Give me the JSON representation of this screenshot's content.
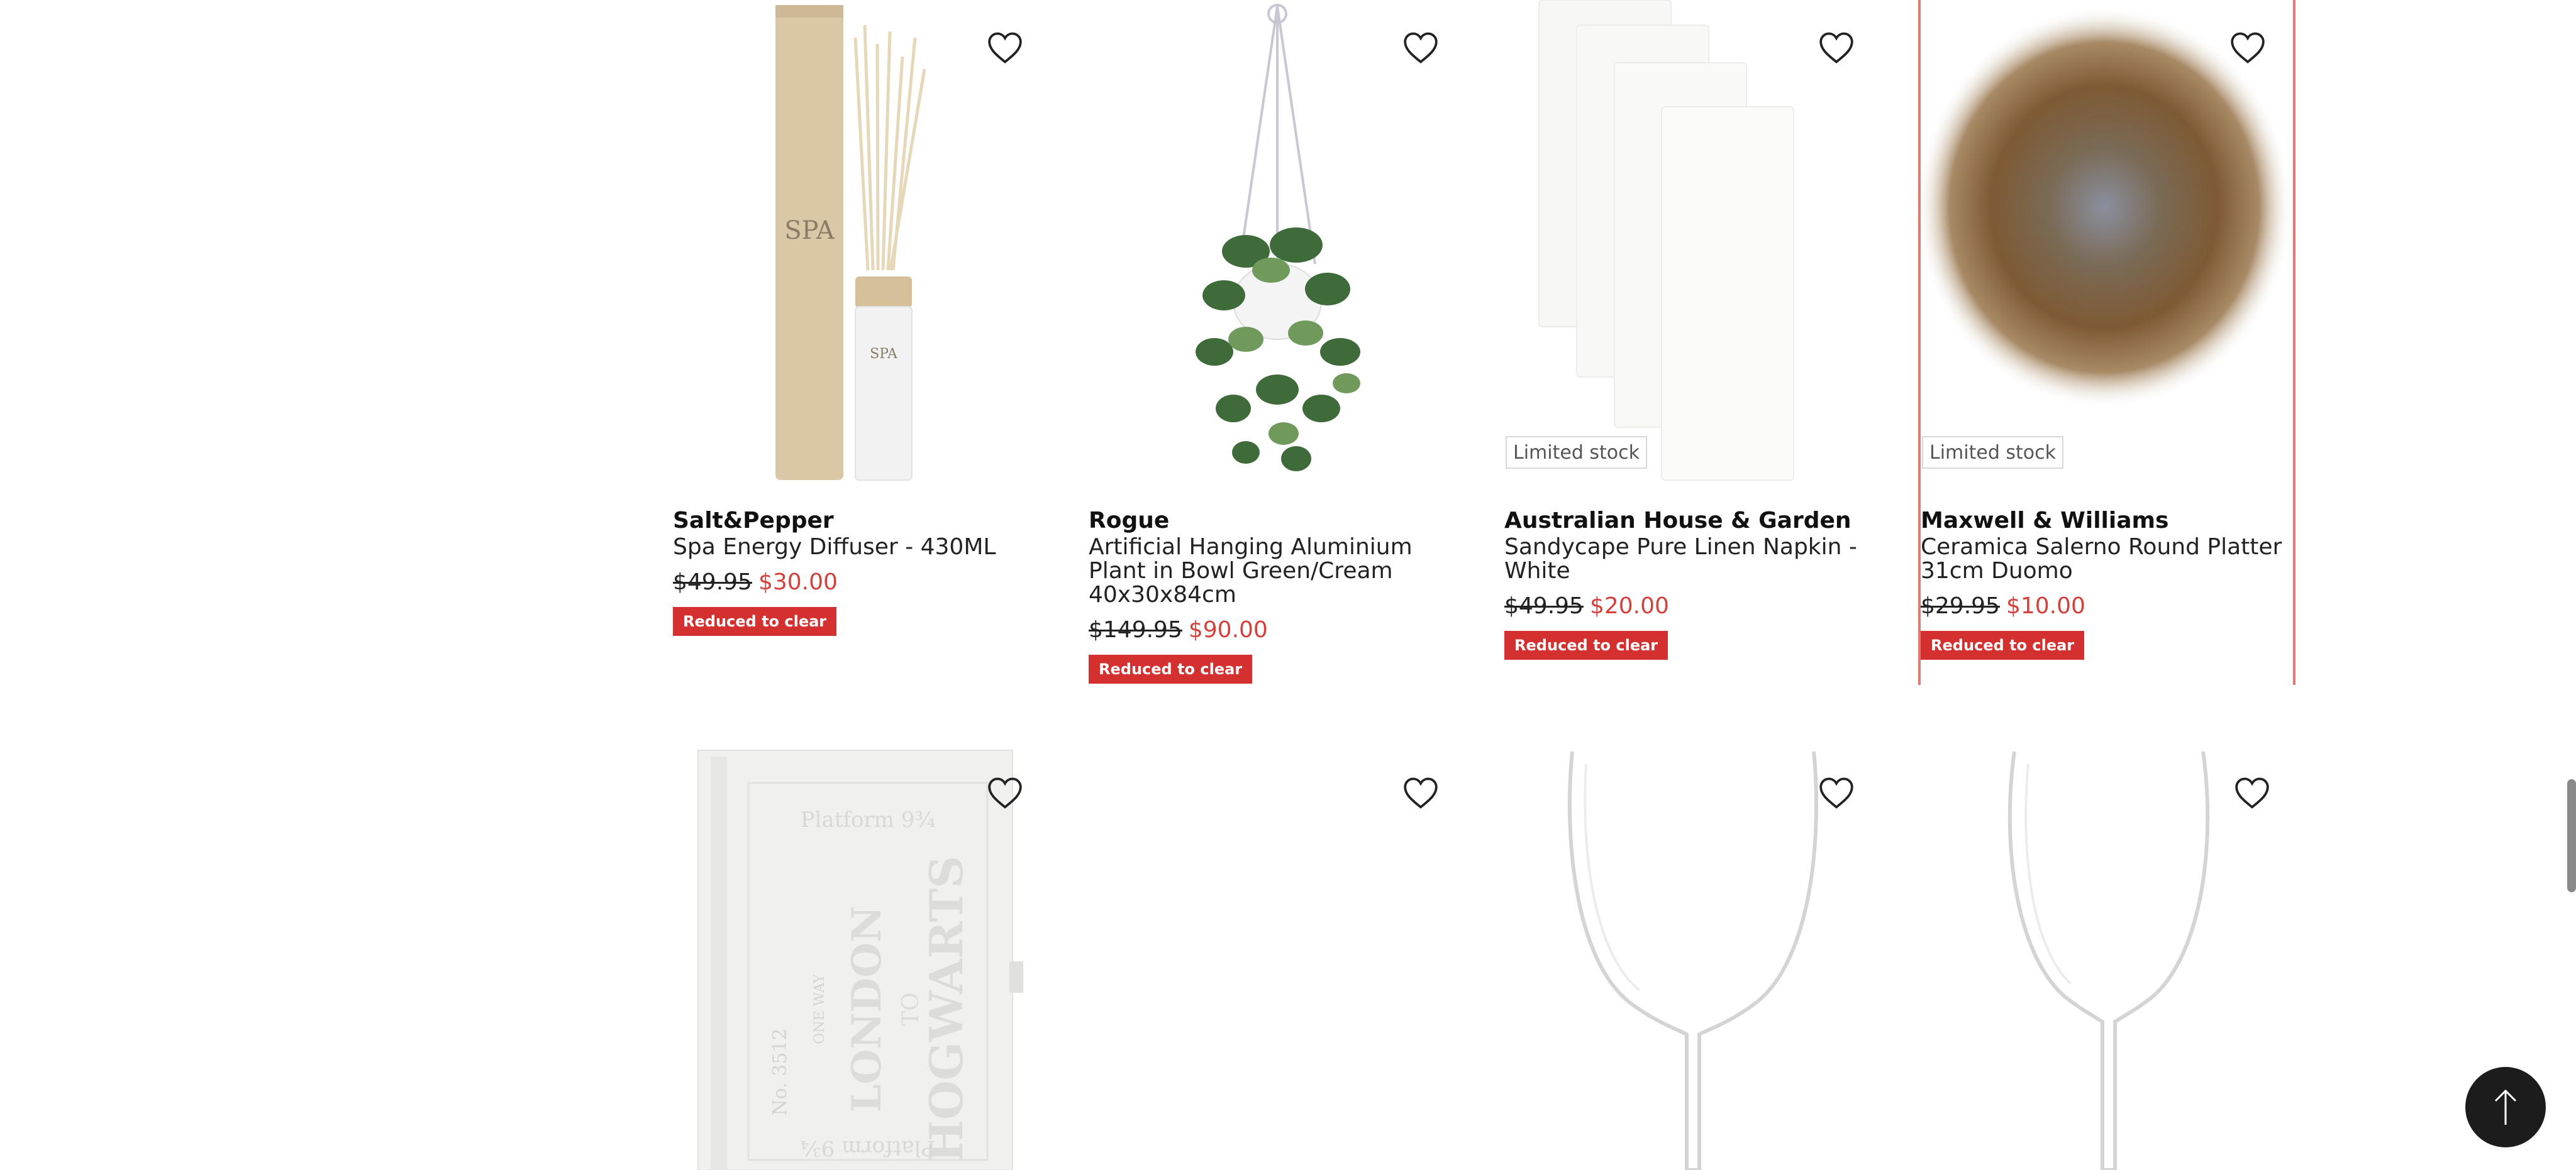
{
  "products": [
    {
      "brand": "Salt&Pepper",
      "name": "Spa Energy Diffuser - 430ML",
      "was_price": "$49.95",
      "now_price": "$30.00",
      "badge": "Reduced to clear",
      "stock": ""
    },
    {
      "brand": "Rogue",
      "name": "Artificial Hanging Aluminium Plant in Bowl Green/Cream 40x30x84cm",
      "was_price": "$149.95",
      "now_price": "$90.00",
      "badge": "Reduced to clear",
      "stock": ""
    },
    {
      "brand": "Australian House & Garden",
      "name": "Sandycape Pure Linen Napkin - White",
      "was_price": "$49.95",
      "now_price": "$20.00",
      "badge": "Reduced to clear",
      "stock": "Limited stock"
    },
    {
      "brand": "Maxwell & Williams",
      "name": "Ceramica Salerno Round Platter 31cm Duomo",
      "was_price": "$29.95",
      "now_price": "$10.00",
      "badge": "Reduced to clear",
      "stock": "Limited stock"
    }
  ],
  "diffuser_label": "SPA",
  "notebook_labels": {
    "top": "Platform 9¾",
    "bottom": "Platform 9¾",
    "main1": "LONDON",
    "main2": "TO",
    "main3": "HOGWARTS",
    "number": "No. 3512",
    "oneway": "ONE WAY"
  },
  "icons": {
    "wishlist": "heart-outline-icon",
    "back_to_top": "arrow-up-icon"
  },
  "colors": {
    "sale_red": "#d4403a",
    "badge_red": "#d3302f",
    "hover_border": "#e07a70",
    "back_to_top_bg": "#1c1c1c"
  }
}
